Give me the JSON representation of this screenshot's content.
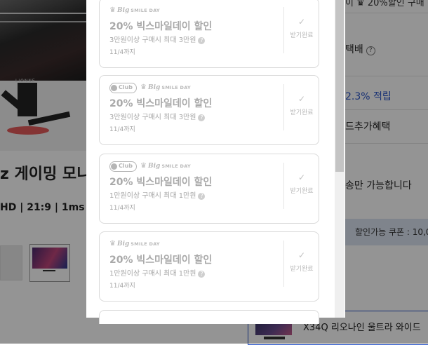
{
  "background": {
    "product_title": "z 게이밍 모니",
    "product_spec": "HD | 21:9 | 1ms",
    "brand_text": "LIONNE",
    "right_top": "이 ♛ 20%할인 구매",
    "right_lines": [
      {
        "text": "택배",
        "help": "?"
      },
      {
        "text": "2.3% 적립",
        "blue": true
      },
      {
        "text": "드추가혜택"
      },
      {
        "text": "송만 가능합니다"
      }
    ],
    "coupon_box_label": "할인가능 쿠폰 : 10,0",
    "bottom_product_name": "X34Q 리오나인 울트라 와이드"
  },
  "coupons": [
    {
      "club": false,
      "badge_crown": "♛",
      "badge_big": "Big",
      "badge_smileday": "SMILE DAY",
      "title": "20% 빅스마일데이 할인",
      "condition": "3만원이상 구매시 최대 3만원",
      "period": "11/4까지",
      "status_label": "받기완료"
    },
    {
      "club": true,
      "club_label": "Club",
      "badge_crown": "♛",
      "badge_big": "Big",
      "badge_smileday": "SMILE DAY",
      "title": "20% 빅스마일데이 할인",
      "condition": "3만원이상 구매시 최대 3만원",
      "period": "11/4까지",
      "status_label": "받기완료"
    },
    {
      "club": true,
      "club_label": "Club",
      "badge_crown": "♛",
      "badge_big": "Big",
      "badge_smileday": "SMILE DAY",
      "title": "20% 빅스마일데이 할인",
      "condition": "1만원이상 구매시 최대 1만원",
      "period": "11/4까지",
      "status_label": "받기완료"
    },
    {
      "club": false,
      "badge_crown": "♛",
      "badge_big": "Big",
      "badge_smileday": "SMILE DAY",
      "title": "20% 빅스마일데이 할인",
      "condition": "1만원이상 구매시 최대 1만원",
      "period": "11/4까지",
      "status_label": "받기완료"
    }
  ],
  "colors": {
    "overlay": "#000000",
    "title_gray": "#a9a9a9",
    "link_blue": "#2a55c8",
    "club_purple": "#6b2fa0"
  }
}
